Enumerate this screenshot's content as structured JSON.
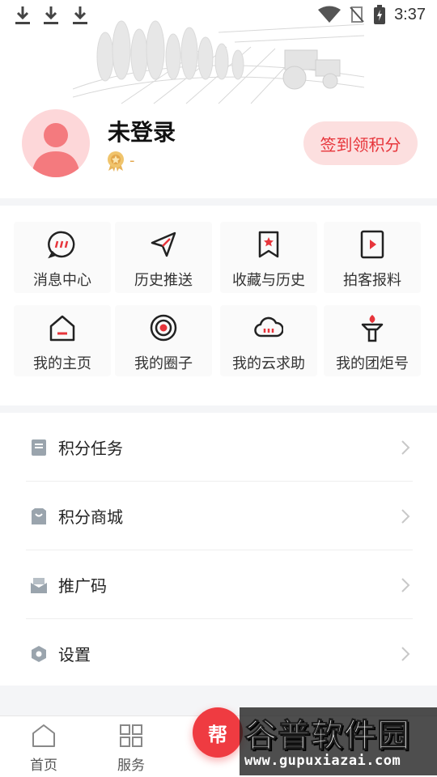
{
  "status_bar": {
    "time": "3:37"
  },
  "profile": {
    "name": "未登录",
    "level": "-",
    "signin_label": "签到领积分"
  },
  "grid": [
    {
      "label": "消息中心",
      "icon": "message-icon"
    },
    {
      "label": "历史推送",
      "icon": "send-icon"
    },
    {
      "label": "收藏与历史",
      "icon": "bookmark-icon"
    },
    {
      "label": "拍客报料",
      "icon": "video-icon"
    },
    {
      "label": "我的主页",
      "icon": "home-icon"
    },
    {
      "label": "我的圈子",
      "icon": "circle-icon"
    },
    {
      "label": "我的云求助",
      "icon": "cloud-icon"
    },
    {
      "label": "我的团炬号",
      "icon": "torch-icon"
    }
  ],
  "menu": [
    {
      "label": "积分任务",
      "icon": "task-icon"
    },
    {
      "label": "积分商城",
      "icon": "shop-icon"
    },
    {
      "label": "推广码",
      "icon": "promo-icon"
    },
    {
      "label": "设置",
      "icon": "settings-icon"
    }
  ],
  "tabbar": {
    "tabs": [
      {
        "label": "首页",
        "icon": "home-tab-icon"
      },
      {
        "label": "服务",
        "icon": "grid-icon"
      }
    ],
    "help_label": "帮"
  },
  "watermark": {
    "title": "谷普软件园",
    "url": "www.gupuxiazai.com"
  },
  "colors": {
    "accent": "#e7353b",
    "signin_bg": "#fcdfdf",
    "avatar_bg": "#fdd7d9",
    "medal": "#e3a64a"
  }
}
